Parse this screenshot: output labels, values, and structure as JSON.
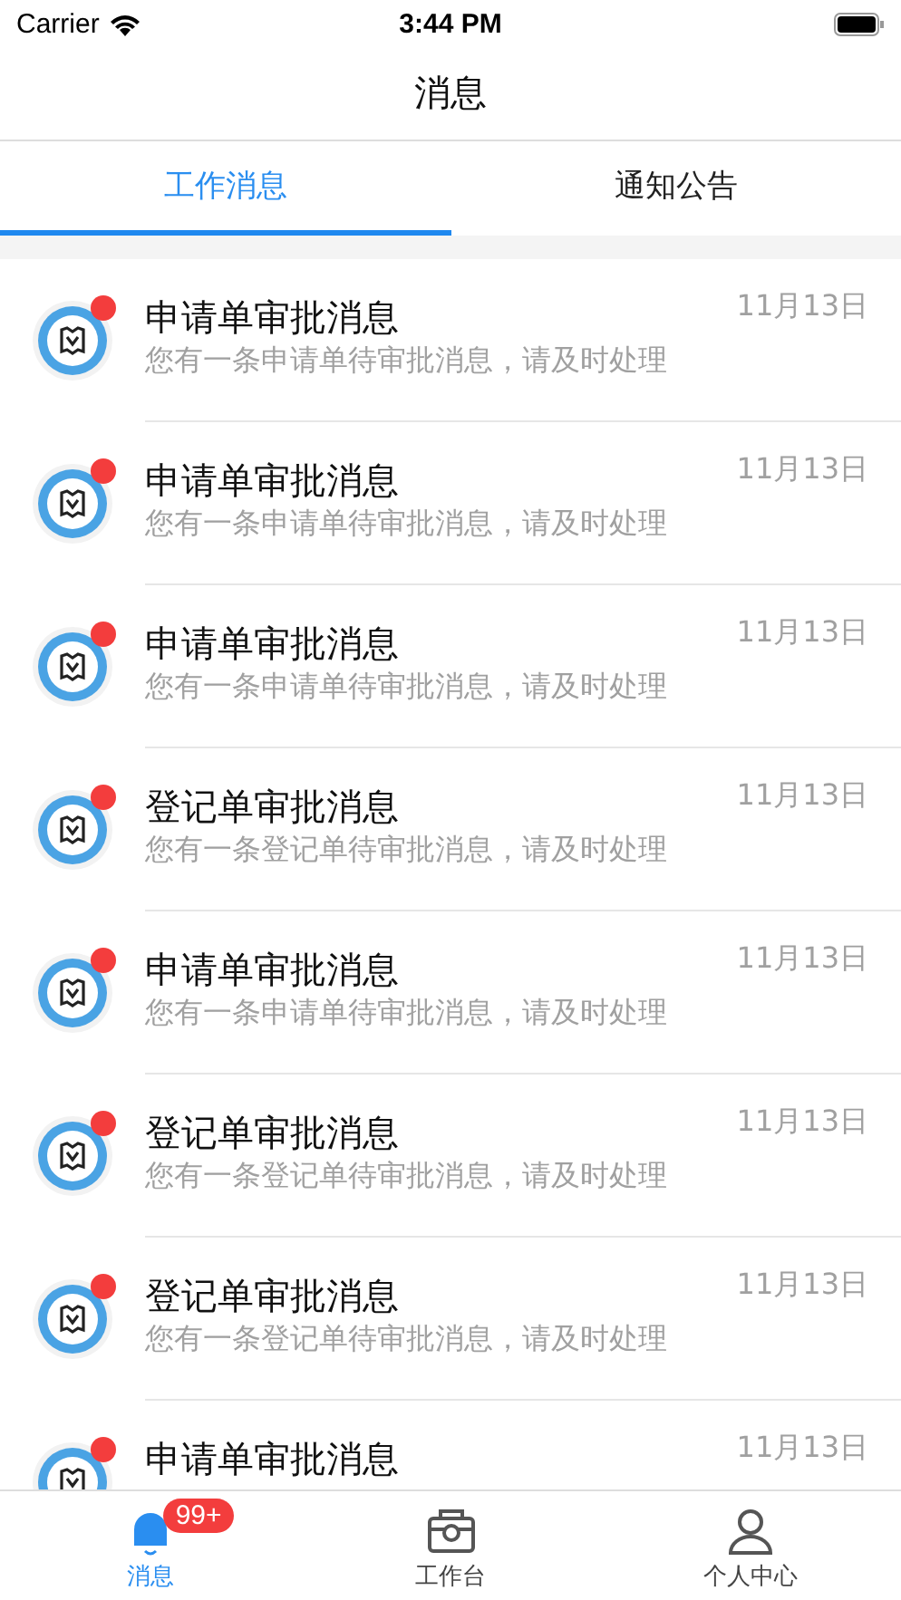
{
  "status_bar": {
    "carrier": "Carrier",
    "time": "3:44 PM"
  },
  "nav": {
    "title": "消息"
  },
  "tabs": [
    {
      "label": "工作消息",
      "selected": true
    },
    {
      "label": "通知公告",
      "selected": false
    }
  ],
  "messages": [
    {
      "title": "申请单审批消息",
      "subtitle": "您有一条申请单待审批消息，请及时处理",
      "date": "11月13日",
      "unread": true
    },
    {
      "title": "申请单审批消息",
      "subtitle": "您有一条申请单待审批消息，请及时处理",
      "date": "11月13日",
      "unread": true
    },
    {
      "title": "申请单审批消息",
      "subtitle": "您有一条申请单待审批消息，请及时处理",
      "date": "11月13日",
      "unread": true
    },
    {
      "title": "登记单审批消息",
      "subtitle": "您有一条登记单待审批消息，请及时处理",
      "date": "11月13日",
      "unread": true
    },
    {
      "title": "申请单审批消息",
      "subtitle": "您有一条申请单待审批消息，请及时处理",
      "date": "11月13日",
      "unread": true
    },
    {
      "title": "登记单审批消息",
      "subtitle": "您有一条登记单待审批消息，请及时处理",
      "date": "11月13日",
      "unread": true
    },
    {
      "title": "登记单审批消息",
      "subtitle": "您有一条登记单待审批消息，请及时处理",
      "date": "11月13日",
      "unread": true
    },
    {
      "title": "申请单审批消息",
      "date": "11月13日",
      "unread": true
    }
  ],
  "tab_bar": [
    {
      "kind": "bell",
      "label": "消息",
      "selected": true,
      "badge": "99+"
    },
    {
      "kind": "camera",
      "label": "工作台",
      "selected": false
    },
    {
      "kind": "person",
      "label": "个人中心",
      "selected": false
    }
  ]
}
